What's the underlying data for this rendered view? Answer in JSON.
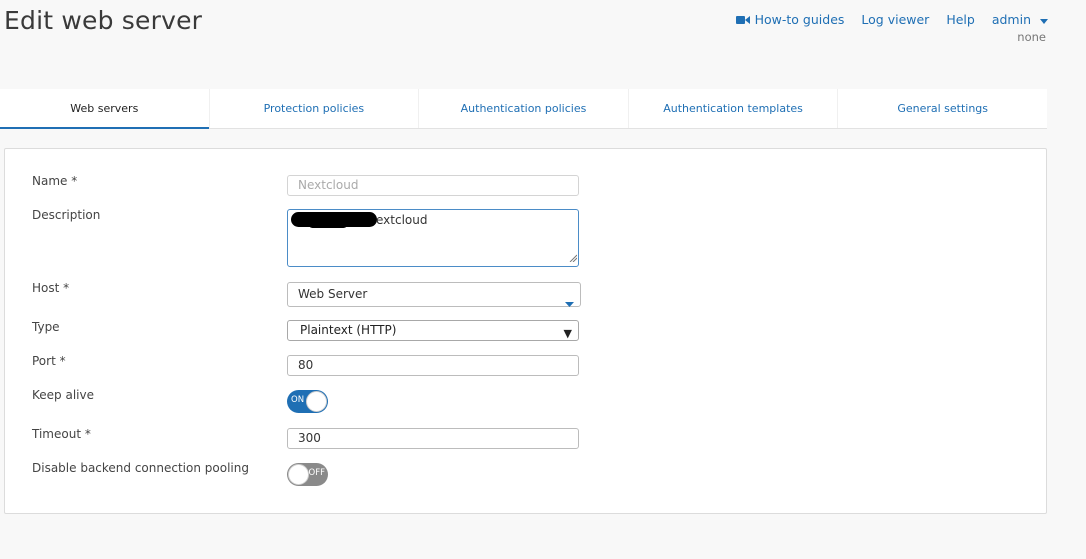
{
  "header": {
    "title": "Edit web server",
    "nav": {
      "howto": "How-to guides",
      "log_viewer": "Log viewer",
      "help": "Help",
      "admin": "admin",
      "admin_sub": "none"
    }
  },
  "tabs": [
    {
      "label": "Web servers",
      "active": true
    },
    {
      "label": "Protection policies",
      "active": false
    },
    {
      "label": "Authentication policies",
      "active": false
    },
    {
      "label": "Authentication templates",
      "active": false
    },
    {
      "label": "General settings",
      "active": false
    }
  ],
  "form": {
    "name": {
      "label": "Name *",
      "placeholder": "Nextcloud",
      "value": ""
    },
    "description": {
      "label": "Description",
      "value": "extcloud"
    },
    "host": {
      "label": "Host *",
      "value": "Web Server"
    },
    "type": {
      "label": "Type",
      "value": "Plaintext (HTTP)"
    },
    "port": {
      "label": "Port *",
      "value": "80"
    },
    "keep_alive": {
      "label": "Keep alive",
      "state": "ON",
      "on": true
    },
    "timeout": {
      "label": "Timeout *",
      "value": "300"
    },
    "disable_pooling": {
      "label": "Disable backend connection pooling",
      "state": "OFF",
      "on": false
    }
  },
  "colors": {
    "accent": "#1f6fb4",
    "toggle_off": "#8a8a8a"
  }
}
